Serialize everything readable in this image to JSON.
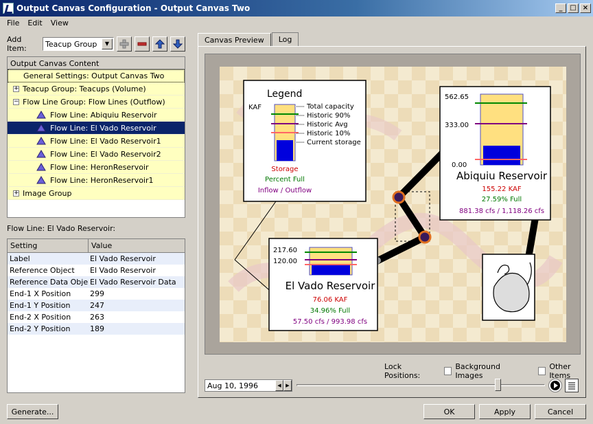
{
  "window": {
    "title": "Output Canvas Configuration - Output Canvas Two"
  },
  "menu": [
    "File",
    "Edit",
    "View"
  ],
  "add_item": {
    "label": "Add Item:",
    "value": "Teacup Group"
  },
  "content": {
    "header": "Output Canvas Content",
    "items": [
      {
        "label": "General Settings: Output Canvas Two",
        "indent": 0,
        "expander": "",
        "icon": false,
        "selected": false,
        "focused": true
      },
      {
        "label": "Teacup Group: Teacups (Volume)",
        "indent": 0,
        "expander": "+",
        "icon": false,
        "selected": false
      },
      {
        "label": "Flow Line Group: Flow Lines (Outflow)",
        "indent": 0,
        "expander": "−",
        "icon": false,
        "selected": false
      },
      {
        "label": "Flow Line: Abiquiu Reservoir",
        "indent": 1,
        "expander": "",
        "icon": true,
        "selected": false
      },
      {
        "label": "Flow Line: El Vado Reservoir",
        "indent": 1,
        "expander": "",
        "icon": true,
        "selected": true
      },
      {
        "label": "Flow Line: El Vado Reservoir1",
        "indent": 1,
        "expander": "",
        "icon": true,
        "selected": false
      },
      {
        "label": "Flow Line: El Vado Reservoir2",
        "indent": 1,
        "expander": "",
        "icon": true,
        "selected": false
      },
      {
        "label": "Flow Line: HeronReservoir",
        "indent": 1,
        "expander": "",
        "icon": true,
        "selected": false
      },
      {
        "label": "Flow Line: HeronReservoir1",
        "indent": 1,
        "expander": "",
        "icon": true,
        "selected": false
      },
      {
        "label": "Image Group",
        "indent": 0,
        "expander": "+",
        "icon": false,
        "selected": false
      }
    ]
  },
  "selection_label": "Flow Line: El Vado Reservoir:",
  "settings": {
    "col_setting": "Setting",
    "col_value": "Value",
    "rows": [
      {
        "setting": "Label",
        "value": "El Vado Reservoir"
      },
      {
        "setting": "Reference Object",
        "value": "El Vado Reservoir"
      },
      {
        "setting": "Reference Data Object",
        "value": "El Vado Reservoir Data"
      },
      {
        "setting": "End-1 X Position",
        "value": "299"
      },
      {
        "setting": "End-1 Y Position",
        "value": "247"
      },
      {
        "setting": "End-2 X Position",
        "value": "263"
      },
      {
        "setting": "End-2 Y Position",
        "value": "189"
      }
    ]
  },
  "tabs": {
    "preview": "Canvas Preview",
    "log": "Log"
  },
  "legend": {
    "title": "Legend",
    "unit": "KAF",
    "items": [
      "Total capacity",
      "Historic 90%",
      "Historic Avg",
      "Historic 10%",
      "Current storage"
    ],
    "storage": "Storage",
    "percent": "Percent Full",
    "flow": "Inflow / Outflow"
  },
  "abiquiu": {
    "max": "562.65",
    "mid": "333.00",
    "min": "0.00",
    "name": "Abiquiu Reservoir",
    "storage": "155.22 KAF",
    "percent": "27.59% Full",
    "flow": "881.38 cfs / 1,118.26 cfs",
    "fill_fraction": 0.276,
    "h90": 0.86,
    "avg": 0.59,
    "h10": 0.06
  },
  "elvado": {
    "max": "217.60",
    "mid": "120.00",
    "name": "El Vado Reservoir",
    "storage": "76.06 KAF",
    "percent": "34.96% Full",
    "flow": "57.50 cfs / 993.98 cfs",
    "fill_fraction": 0.35,
    "h90": 0.82,
    "avg": 0.55,
    "h10": 0.23
  },
  "lock": {
    "label": "Lock Positions:",
    "bg": "Background Images",
    "other": "Other Items"
  },
  "date": "Aug 10, 1996",
  "slider_fraction": 0.81,
  "buttons": {
    "generate": "Generate...",
    "ok": "OK",
    "apply": "Apply",
    "cancel": "Cancel"
  },
  "colors": {
    "storage": "#cc0000",
    "percent": "#007700",
    "flow": "#800080",
    "fill": "#0000dd",
    "h90": "#008800",
    "avg": "#800080",
    "h10": "#ff6666",
    "cup": "#ffe080"
  }
}
